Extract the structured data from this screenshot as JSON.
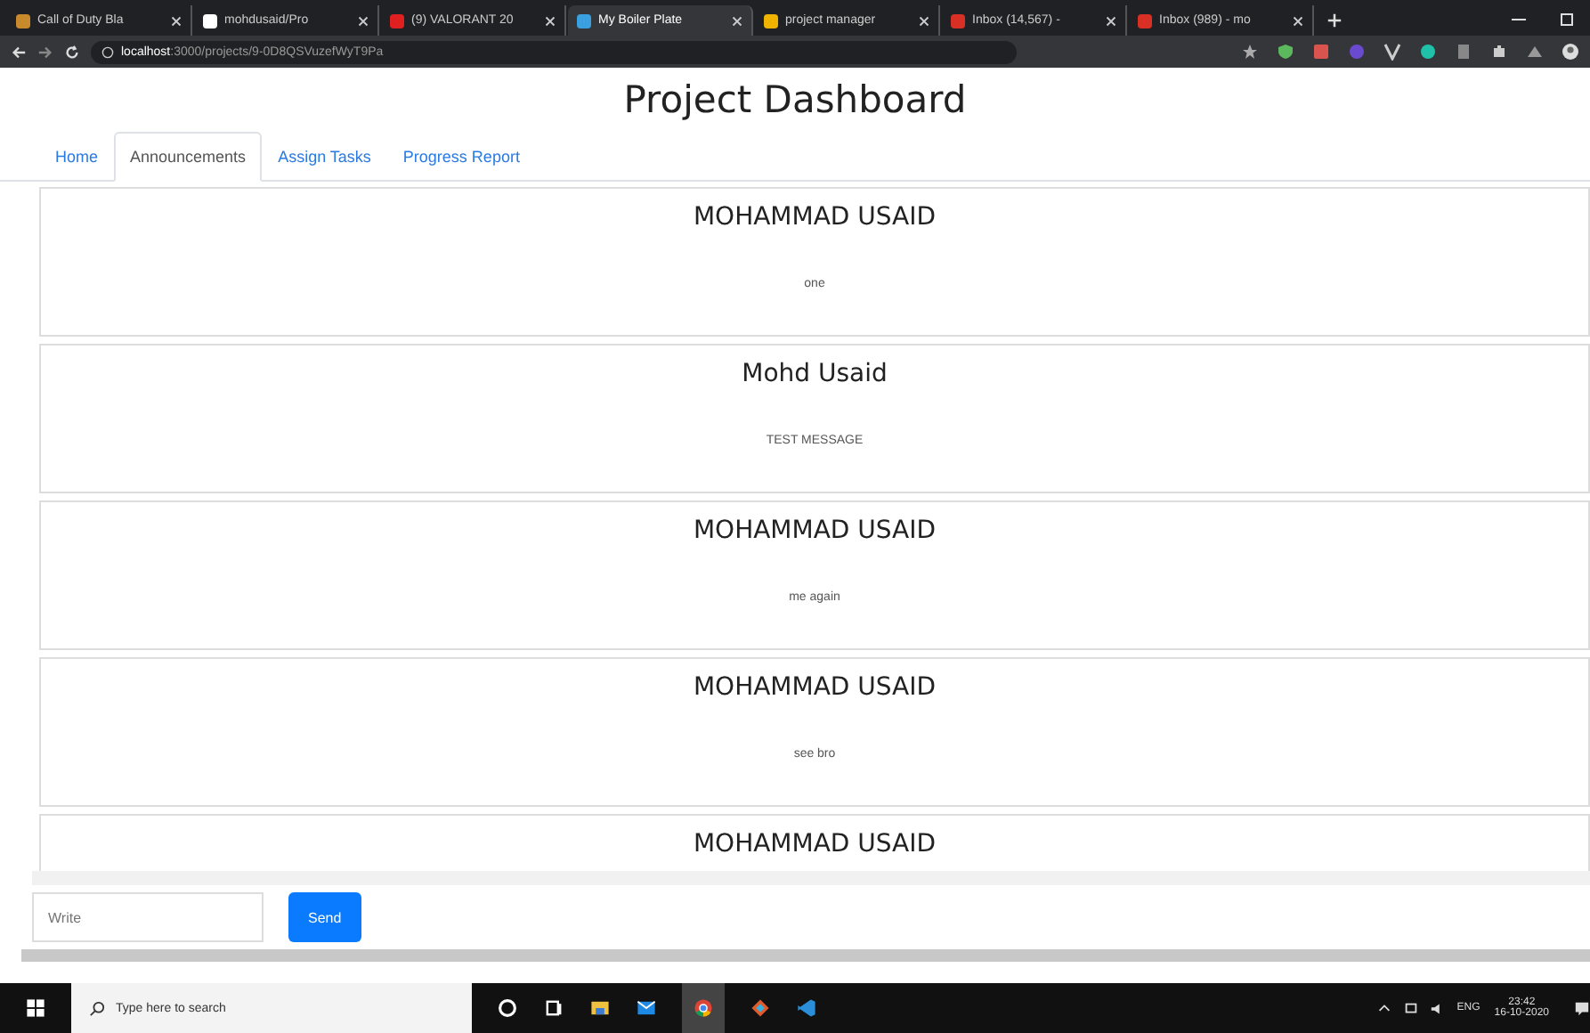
{
  "browser": {
    "tabs": [
      {
        "title": "Call of Duty Bla",
        "selected": false,
        "color": "#c98a2b"
      },
      {
        "title": "mohdusaid/Pro",
        "selected": false,
        "color": "#ffffff"
      },
      {
        "title": "(9) VALORANT 20",
        "selected": false,
        "color": "#e02020"
      },
      {
        "title": "My Boiler Plate",
        "selected": true,
        "color": "#3aa0e0"
      },
      {
        "title": "project manager",
        "selected": false,
        "color": "#f0b400"
      },
      {
        "title": "Inbox (14,567) -",
        "selected": false,
        "color": "#d93025"
      },
      {
        "title": "Inbox (989) - mo",
        "selected": false,
        "color": "#d93025"
      }
    ],
    "url_host": "localhost",
    "url_path": ":3000/projects/9-0D8QSVuzefWyT9Pa"
  },
  "page": {
    "title": "Project Dashboard",
    "nav": [
      {
        "label": "Home",
        "selected": false
      },
      {
        "label": "Announcements",
        "selected": true
      },
      {
        "label": "Assign Tasks",
        "selected": false
      },
      {
        "label": "Progress Report",
        "selected": false
      }
    ],
    "messages": [
      {
        "author": "MOHAMMAD USAID",
        "text": "one"
      },
      {
        "author": "Mohd Usaid",
        "text": "TEST MESSAGE"
      },
      {
        "author": "MOHAMMAD USAID",
        "text": "me again"
      },
      {
        "author": "MOHAMMAD USAID",
        "text": "see bro"
      },
      {
        "author": "MOHAMMAD USAID"
      }
    ],
    "composer": {
      "placeholder": "Write",
      "button": "Send"
    }
  },
  "taskbar": {
    "search_placeholder": "Type here to search",
    "language": "ENG",
    "time": "23:42",
    "date": "16-10-2020"
  }
}
